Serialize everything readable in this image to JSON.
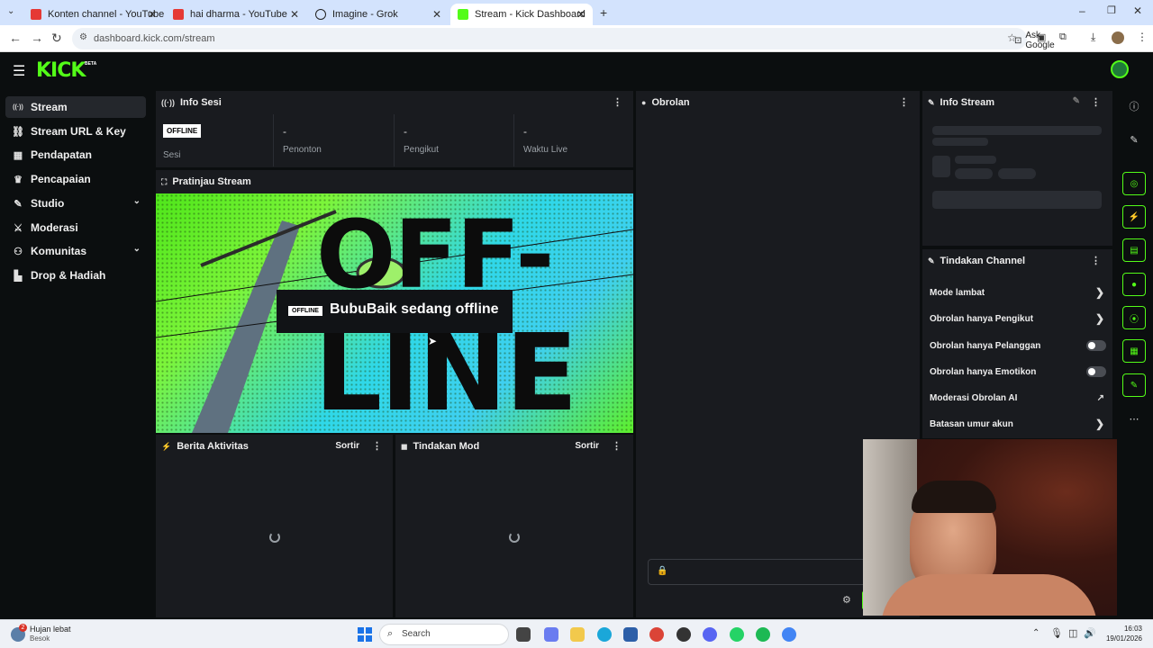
{
  "browser": {
    "tabs": [
      {
        "label": "Konten channel - YouTube Stud",
        "color": "#e53935"
      },
      {
        "label": "hai dharma - YouTube",
        "color": "#e53935"
      },
      {
        "label": "Imagine - Grok",
        "color": "#222222"
      },
      {
        "label": "Stream - Kick Dashboard",
        "color": "#53fc18"
      }
    ],
    "url": "dashboard.kick.com/stream",
    "ask_google": "Ask Google"
  },
  "brand": {
    "logo": "KICK",
    "beta": "BETA",
    "accent": "#53fc18"
  },
  "sidebar": {
    "items": [
      {
        "label": "Stream",
        "icon": "broadcast-icon",
        "glyph": "((·))"
      },
      {
        "label": "Stream URL & Key",
        "icon": "link-icon",
        "glyph": "⛓"
      },
      {
        "label": "Pendapatan",
        "icon": "chart-icon",
        "glyph": "▦"
      },
      {
        "label": "Pencapaian",
        "icon": "trophy-icon",
        "glyph": "🏆"
      },
      {
        "label": "Studio",
        "icon": "brush-icon",
        "glyph": "✎"
      },
      {
        "label": "Moderasi",
        "icon": "sword-icon",
        "glyph": "⚔"
      },
      {
        "label": "Komunitas",
        "icon": "people-icon",
        "glyph": "👥"
      },
      {
        "label": "Drop & Hadiah",
        "icon": "gift-icon",
        "glyph": "▙"
      }
    ]
  },
  "session": {
    "title": "Info Sesi",
    "badge": "OFFLINE",
    "stats": [
      {
        "value": "",
        "label": "Sesi"
      },
      {
        "value": "-",
        "label": "Penonton"
      },
      {
        "value": "-",
        "label": "Pengikut"
      },
      {
        "value": "-",
        "label": "Waktu Live"
      }
    ]
  },
  "preview": {
    "title": "Pratinjau Stream",
    "badge": "OFFLINE",
    "message": "BubuBaik sedang offline",
    "big_text_1": "OFF-",
    "big_text_2": "LINE"
  },
  "activity": {
    "title": "Berita Aktivitas",
    "sort": "Sortir"
  },
  "modactions": {
    "title": "Tindakan Mod",
    "sort": "Sortir"
  },
  "chat": {
    "title": "Obrolan"
  },
  "streaminfo": {
    "title": "Info Stream"
  },
  "channel": {
    "title": "Tindakan Channel",
    "actions": [
      {
        "label": "Mode lambat",
        "control": "arrow"
      },
      {
        "label": "Obrolan hanya Pengikut",
        "control": "arrow"
      },
      {
        "label": "Obrolan hanya Pelanggan",
        "control": "toggle"
      },
      {
        "label": "Obrolan hanya Emotikon",
        "control": "toggle"
      },
      {
        "label": "Moderasi Obrolan AI",
        "control": "external"
      },
      {
        "label": "Batasan umur akun",
        "control": "arrow"
      }
    ]
  },
  "taskbar": {
    "weather_badge": "2",
    "weather_title": "Hujan lebat",
    "weather_sub": "Besok",
    "search": "Search",
    "time": "16:03",
    "date": "19/01/2026"
  }
}
